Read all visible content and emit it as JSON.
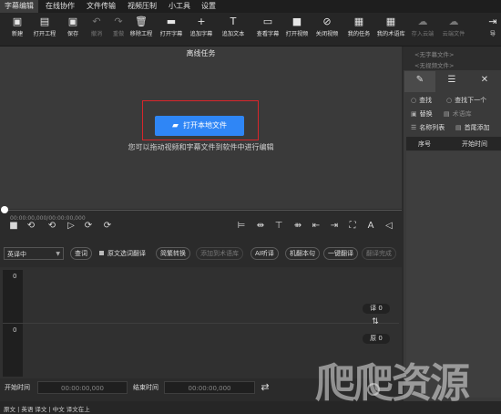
{
  "menu": [
    "字幕编辑",
    "在线协作",
    "文件传输",
    "视频压制",
    "小工具",
    "设置"
  ],
  "toolbar": [
    {
      "icon": "new-icon",
      "glyph": "▣",
      "label": "新建"
    },
    {
      "icon": "open-project-icon",
      "glyph": "▤",
      "label": "打开工程"
    },
    {
      "icon": "save-icon",
      "glyph": "▣",
      "label": "保存"
    },
    {
      "icon": "undo-icon",
      "glyph": "↶",
      "label": "撤消"
    },
    {
      "icon": "redo-icon",
      "glyph": "↷",
      "label": "重做"
    },
    {
      "icon": "trash-icon",
      "glyph": "🗑",
      "label": "移除工程"
    },
    {
      "icon": "folder-icon",
      "glyph": "▬",
      "label": "打开字幕"
    },
    {
      "icon": "plus-icon",
      "glyph": "+",
      "label": "追加字幕"
    },
    {
      "icon": "text-icon",
      "glyph": "T",
      "label": "追加文本"
    },
    {
      "icon": "subtitle-icon",
      "glyph": "▭",
      "label": "查看字幕"
    },
    {
      "icon": "video-icon",
      "glyph": "■",
      "label": "打开视频"
    },
    {
      "icon": "close-video-icon",
      "glyph": "⊘",
      "label": "关闭视频"
    },
    {
      "icon": "task-icon",
      "glyph": "▦",
      "label": "我的任务"
    },
    {
      "icon": "translation-icon",
      "glyph": "▦",
      "label": "我的术语库"
    },
    {
      "icon": "cloud-upload-icon",
      "glyph": "☁",
      "label": "存入云端"
    },
    {
      "icon": "cloud-file-icon",
      "glyph": "☁",
      "label": "云端文件"
    },
    {
      "icon": "export-icon",
      "glyph": "⇥",
      "label": "导"
    }
  ],
  "preview": {
    "title": "离线任务",
    "open_button": "打开本地文件",
    "hint": "您可以拖动视频和字幕文件到软件中进行编辑"
  },
  "timeline": {
    "readout": "00:00:00,000/00:00:00,000",
    "progress": 0
  },
  "options": {
    "language": "英译中",
    "btn_watch": "查词",
    "chk_label": "原文选词翻译",
    "btn_convert": "简繁转换",
    "btn_term": "添加到术语库",
    "btn_ai": "AI听译",
    "btn_machine": "机翻本句",
    "btn_one_click": "一键翻译",
    "btn_done": "翻译完成"
  },
  "editor": {
    "upper_index": "0",
    "lower_index": "0",
    "translation_count": "译 0",
    "source_count": "原 0"
  },
  "timerow": {
    "start_label": "开始时间",
    "start_value": "00:00:00,000",
    "end_label": "结束时间",
    "end_value": "00:00:00,000"
  },
  "status": "原文 | 英语 译文 | 中文   译文在上",
  "right_panel": {
    "no_subtitle": "<无字幕文件>",
    "no_video": "<无视频文件>",
    "find": "查找",
    "find_next": "查找下一个",
    "replace": "替换",
    "term_label": "术语库",
    "name_list": "名称列表",
    "first_add": "首尾添加",
    "col_index": "序号",
    "col_start": "开始时间"
  },
  "watermark": "爬爬资源"
}
